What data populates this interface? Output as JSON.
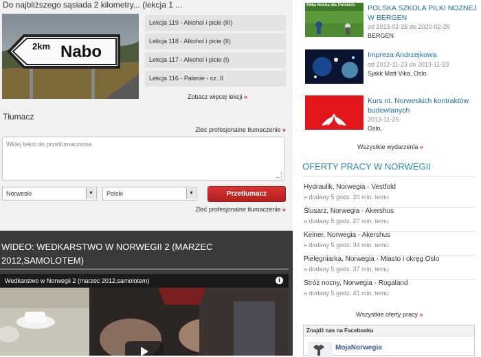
{
  "lesson": {
    "title": "Do najbliższego sąsiada 2 kilometry... (lekcja 1 ...",
    "sign": {
      "distance": "2km",
      "name": "Nabo"
    },
    "items": [
      {
        "label": "Lekcja 119 - Alkohol i picie (III)"
      },
      {
        "label": "Lekcja 118 - Alkohol i picie (II)"
      },
      {
        "label": "Lekcja 117 - Alkohol i picie (I)"
      },
      {
        "label": "Lekcja 116 - Palenie - cz. II"
      }
    ],
    "more_label": "Zobacz więcej lekcji",
    "arrow": "»"
  },
  "translator": {
    "heading": "Tłumacz",
    "pro_label": "Zleć profesjonalne tłumaczenie",
    "placeholder": "Wklej tekst do przetłumaczenia",
    "from_lang": "Norweski",
    "to_lang": "Polski",
    "button": "Przetłumacz",
    "select_arrow": "▼"
  },
  "video": {
    "heading": "WIDEO: WEDKARSTWO W NORWEGII 2 (MARZEC 2012,SAMOLOTEM)",
    "player_title": "Wedkarstwo w Norwegii 2 (marzec 2012,samolotem)",
    "info_glyph": "i"
  },
  "events": {
    "items": [
      {
        "title": "POLSKA SZKOLA PILKI NOZNEJ W BERGEN",
        "date": "od 2013-02-26 do 2020-02-26",
        "place": "BERGEN",
        "image_caption": "Piłka Nożna dla Polskich"
      },
      {
        "title": "Impreza Andrzejkowa",
        "date": "od 2012-11-23 do 2013-11-23",
        "place": "Sjakk Matt Vika, Oslo"
      },
      {
        "title": "Kurs nt. Norweskich kontraktów budowlanych",
        "date": "2013-11-25",
        "place": "Oslo,"
      }
    ],
    "all_label": "Wszystkie wydarzenia"
  },
  "jobs": {
    "heading": "OFERTY PRACY W NORWEGII",
    "items": [
      {
        "title": "Hydraulik, Norwegia - Vestfold",
        "added": "dodany 5 godz. 20 min. temu"
      },
      {
        "title": "Ślusarz, Norwegia - Akershus",
        "added": "dodany 5 godz. 27 min. temu"
      },
      {
        "title": "Kelner, Norwegia - Akershus",
        "added": "dodany 5 godz. 34 min. temu"
      },
      {
        "title": "Pielęgniarka, Norwegia - Miasto i okręg Oslo",
        "added": "dodany 5 godz. 37 min. temu"
      },
      {
        "title": "Stróż nocny, Norwegia - Rogaland",
        "added": "dodany 5 godz. 41 min. temu"
      }
    ],
    "all_label": "Wszystkie oferty pracy"
  },
  "facebook": {
    "heading": "Znajdź nas na Facebooku",
    "page_name": "MojaNorwegia"
  },
  "colors": {
    "accent_blue": "#2a8bb3",
    "link_blue": "#1a6fa0",
    "button_red": "#c62828",
    "arrow_red": "#cc2222"
  }
}
